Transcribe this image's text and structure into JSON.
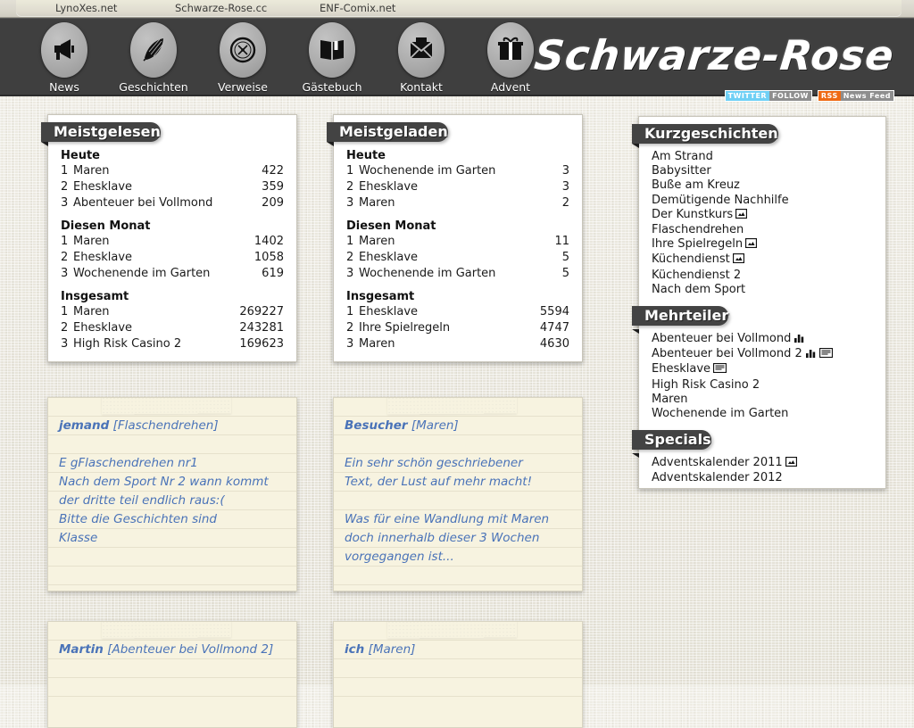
{
  "topbar": {
    "links": [
      "LynoXes.net",
      "Schwarze-Rose.cc",
      "ENF-Comix.net"
    ]
  },
  "header": {
    "site_title": "Schwarze-Rose",
    "nav": [
      {
        "label": "News",
        "icon": "megaphone-icon"
      },
      {
        "label": "Geschichten",
        "icon": "feather-quill-icon"
      },
      {
        "label": "Verweise",
        "icon": "compass-icon"
      },
      {
        "label": "Gästebuch",
        "icon": "open-book-icon"
      },
      {
        "label": "Kontakt",
        "icon": "envelope-icon"
      },
      {
        "label": "Advent",
        "icon": "gift-icon"
      }
    ],
    "badges": {
      "twitter_left": "TWITTER",
      "twitter_right": "FOLLOW",
      "rss_left": "RSS",
      "rss_right": "News Feed"
    },
    "colors": {
      "header_bg": "#3f3f3f",
      "twitter_blue": "#6fd0f5",
      "rss_orange": "#ef6a14",
      "panel_header": "#434343",
      "comment_text": "#4a73b8",
      "comment_bg": "#f7f3e0"
    }
  },
  "panels": {
    "meistgelesen": {
      "title": "Meistgelesen",
      "groups": [
        {
          "label": "Heute",
          "rows": [
            {
              "rank": "1",
              "name": "Maren",
              "value": "422"
            },
            {
              "rank": "2",
              "name": "Ehesklave",
              "value": "359"
            },
            {
              "rank": "3",
              "name": "Abenteuer bei Vollmond",
              "value": "209"
            }
          ]
        },
        {
          "label": "Diesen Monat",
          "rows": [
            {
              "rank": "1",
              "name": "Maren",
              "value": "1402"
            },
            {
              "rank": "2",
              "name": "Ehesklave",
              "value": "1058"
            },
            {
              "rank": "3",
              "name": "Wochenende im Garten",
              "value": "619"
            }
          ]
        },
        {
          "label": "Insgesamt",
          "rows": [
            {
              "rank": "1",
              "name": "Maren",
              "value": "269227"
            },
            {
              "rank": "2",
              "name": "Ehesklave",
              "value": "243281"
            },
            {
              "rank": "3",
              "name": "High Risk Casino 2",
              "value": "169623"
            }
          ]
        }
      ]
    },
    "meistgeladen": {
      "title": "Meistgeladen",
      "groups": [
        {
          "label": "Heute",
          "rows": [
            {
              "rank": "1",
              "name": "Wochenende im Garten",
              "value": "3"
            },
            {
              "rank": "2",
              "name": "Ehesklave",
              "value": "3"
            },
            {
              "rank": "3",
              "name": "Maren",
              "value": "2"
            }
          ]
        },
        {
          "label": "Diesen Monat",
          "rows": [
            {
              "rank": "1",
              "name": "Maren",
              "value": "11"
            },
            {
              "rank": "2",
              "name": "Ehesklave",
              "value": "5"
            },
            {
              "rank": "3",
              "name": "Wochenende im Garten",
              "value": "5"
            }
          ]
        },
        {
          "label": "Insgesamt",
          "rows": [
            {
              "rank": "1",
              "name": "Ehesklave",
              "value": "5594"
            },
            {
              "rank": "2",
              "name": "Ihre Spielregeln",
              "value": "4747"
            },
            {
              "rank": "3",
              "name": "Maren",
              "value": "4630"
            }
          ]
        }
      ]
    }
  },
  "sidebar": {
    "sections": [
      {
        "title": "Kurzgeschichten",
        "items": [
          {
            "label": "Am Strand",
            "icons": []
          },
          {
            "label": "Babysitter",
            "icons": []
          },
          {
            "label": "Buße am Kreuz",
            "icons": []
          },
          {
            "label": "Demütigende Nachhilfe",
            "icons": []
          },
          {
            "label": "Der Kunstkurs",
            "icons": [
              "picture-icon"
            ]
          },
          {
            "label": "Flaschendrehen",
            "icons": []
          },
          {
            "label": "Ihre Spielregeln",
            "icons": [
              "picture-icon"
            ]
          },
          {
            "label": "Küchendienst",
            "icons": [
              "picture-icon"
            ]
          },
          {
            "label": "Küchendienst 2",
            "icons": []
          },
          {
            "label": "Nach dem Sport",
            "icons": []
          }
        ]
      },
      {
        "title": "Mehrteiler",
        "items": [
          {
            "label": "Abenteuer bei Vollmond",
            "icons": [
              "bar-chart-icon"
            ]
          },
          {
            "label": "Abenteuer bei Vollmond 2",
            "icons": [
              "bar-chart-icon",
              "text-document-icon"
            ]
          },
          {
            "label": "Ehesklave",
            "icons": [
              "text-document-icon"
            ]
          },
          {
            "label": "High Risk Casino 2",
            "icons": []
          },
          {
            "label": "Maren",
            "icons": []
          },
          {
            "label": "Wochenende im Garten",
            "icons": []
          }
        ]
      },
      {
        "title": "Specials",
        "items": [
          {
            "label": "Adventskalender 2011",
            "icons": [
              "picture-icon"
            ]
          },
          {
            "label": "Adventskalender 2012",
            "icons": []
          }
        ]
      }
    ]
  },
  "comments": [
    {
      "author": "jemand",
      "subject": "[Flaschendrehen]",
      "lines": [
        "E gFlaschendrehen nr1",
        "Nach dem Sport Nr 2 wann kommt",
        "der dritte teil endlich raus:(",
        "Bitte die Geschichten sind",
        "Klasse"
      ]
    },
    {
      "author": "Besucher",
      "subject": "[Maren]",
      "lines": [
        "Ein sehr schön geschriebener",
        "Text, der Lust auf mehr macht!",
        "",
        "Was für eine Wandlung mit Maren",
        "doch innerhalb dieser 3 Wochen",
        "vorgegangen ist..."
      ]
    },
    {
      "author": "Martin",
      "subject": "[Abenteuer bei Vollmond 2]",
      "lines": []
    },
    {
      "author": "ich",
      "subject": "[Maren]",
      "lines": []
    }
  ]
}
